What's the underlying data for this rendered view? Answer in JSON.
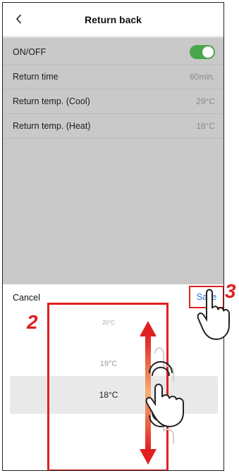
{
  "header": {
    "title": "Return back",
    "back_icon": "chevron-left-icon"
  },
  "settings": {
    "onoff_label": "ON/OFF",
    "onoff_state": true,
    "rows": [
      {
        "label": "Return time",
        "value": "60min."
      },
      {
        "label": "Return temp.  (Cool)",
        "value": "29°C"
      },
      {
        "label": "Return temp.  (Heat)",
        "value": "18°C"
      }
    ]
  },
  "sheet": {
    "cancel_label": "Cancel",
    "save_label": "Save",
    "options": [
      "20°C",
      "19°C",
      "18°C"
    ],
    "selected": "18°C"
  },
  "annotations": {
    "step2": "2",
    "step3": "3"
  },
  "colors": {
    "accent_red": "#e02020",
    "toggle_green": "#49a64c",
    "link_blue": "#2b6ed4"
  }
}
